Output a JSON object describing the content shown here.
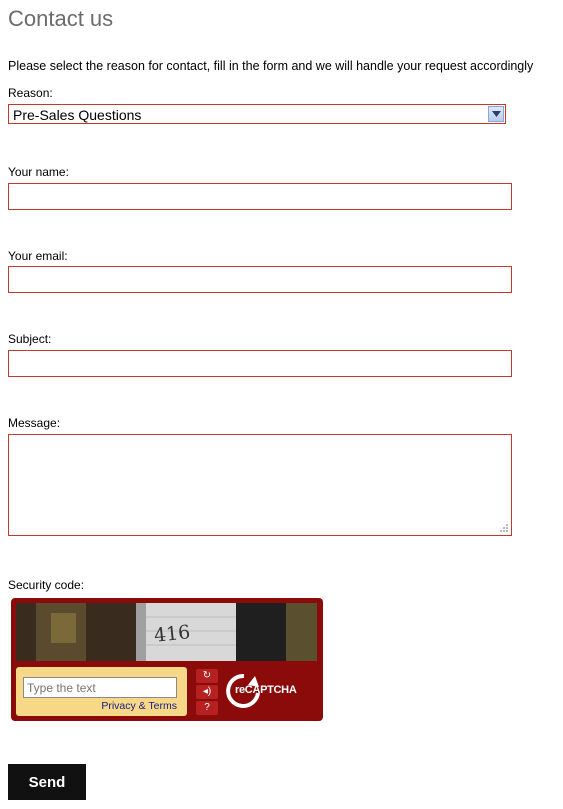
{
  "page": {
    "title": "Contact us",
    "intro": "Please select the reason for contact, fill in the form and we will handle your request accordingly"
  },
  "form": {
    "reason_label": "Reason:",
    "reason_value": "Pre-Sales Questions",
    "name_label": "Your name:",
    "email_label": "Your email:",
    "subject_label": "Subject:",
    "message_label": "Message:",
    "security_label": "Security code:"
  },
  "captcha": {
    "input_placeholder": "Type the text",
    "privacy_link": "Privacy & Terms",
    "image_text": "416",
    "logo_text": "reCAPTCHA"
  },
  "actions": {
    "send_label": "Send"
  },
  "colors": {
    "field_border": "#c0392b",
    "captcha_bg": "#8b0b0b",
    "captcha_input_bg": "#f6d887",
    "button_bg": "#111111"
  }
}
